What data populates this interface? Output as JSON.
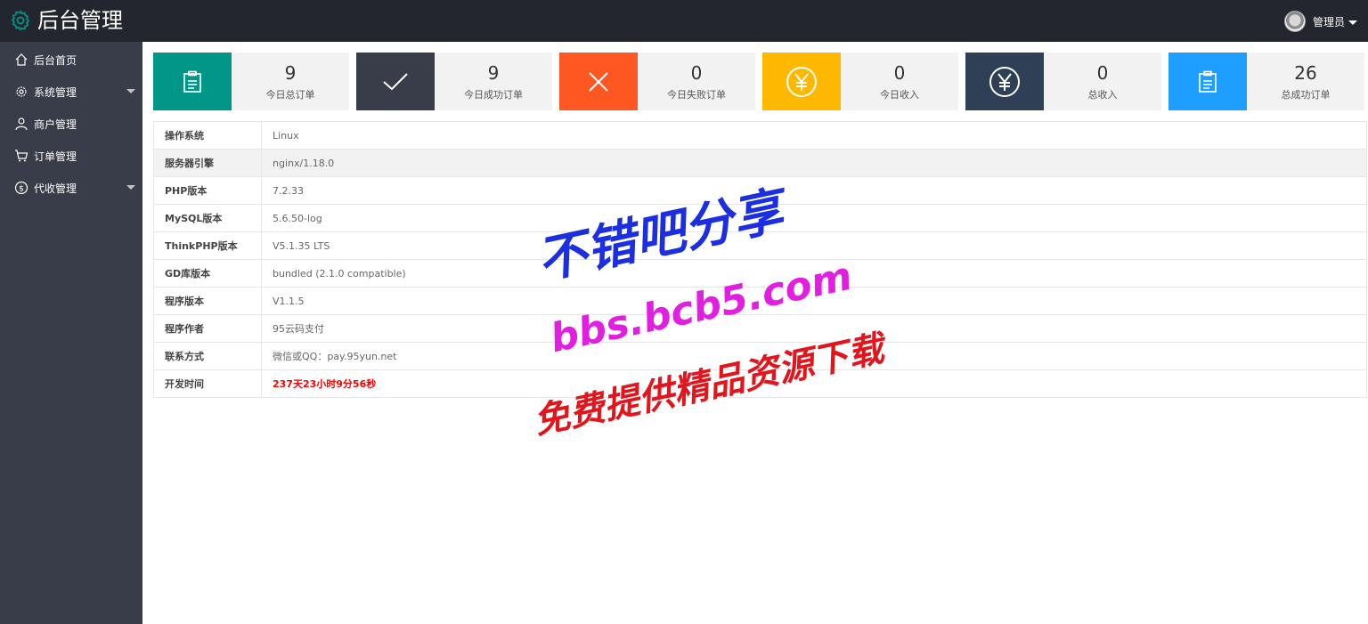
{
  "header": {
    "title": "后台管理",
    "user": "管理员"
  },
  "sidebar": {
    "items": [
      {
        "label": "后台首页",
        "icon": "home-icon"
      },
      {
        "label": "系统管理",
        "icon": "gear-icon"
      },
      {
        "label": "商户管理",
        "icon": "user-icon"
      },
      {
        "label": "订单管理",
        "icon": "cart-icon"
      },
      {
        "label": "代收管理",
        "icon": "dollar-icon"
      }
    ]
  },
  "cards": [
    {
      "value": "9",
      "label": "今日总订单",
      "color": "#009688",
      "icon": "clipboard-icon"
    },
    {
      "value": "9",
      "label": "今日成功订单",
      "color": "#393d49",
      "icon": "check-icon"
    },
    {
      "value": "0",
      "label": "今日失败订单",
      "color": "#ff5722",
      "icon": "close-icon"
    },
    {
      "value": "0",
      "label": "今日收入",
      "color": "#ffb800",
      "icon": "yen-icon"
    },
    {
      "value": "0",
      "label": "总收入",
      "color": "#2f4056",
      "icon": "yen-icon"
    },
    {
      "value": "26",
      "label": "总成功订单",
      "color": "#1e9fff",
      "icon": "clipboard-icon"
    }
  ],
  "info": [
    {
      "key": "操作系统",
      "value": "Linux"
    },
    {
      "key": "服务器引擎",
      "value": "nginx/1.18.0"
    },
    {
      "key": "PHP版本",
      "value": "7.2.33"
    },
    {
      "key": "MySQL版本",
      "value": "5.6.50-log"
    },
    {
      "key": "ThinkPHP版本",
      "value": "V5.1.35 LTS"
    },
    {
      "key": "GD库版本",
      "value": "bundled (2.1.0 compatible)"
    },
    {
      "key": "程序版本",
      "value": "V1.1.5"
    },
    {
      "key": "程序作者",
      "value": "95云码支付"
    },
    {
      "key": "联系方式",
      "value": "微信或QQ：pay.95yun.net"
    },
    {
      "key": "开发时间",
      "value": "237天23小时9分56秒"
    }
  ],
  "watermark": {
    "line1": "不错吧分享",
    "line2": "bbs.bcb5.com",
    "line3": "免费提供精品资源下载"
  }
}
